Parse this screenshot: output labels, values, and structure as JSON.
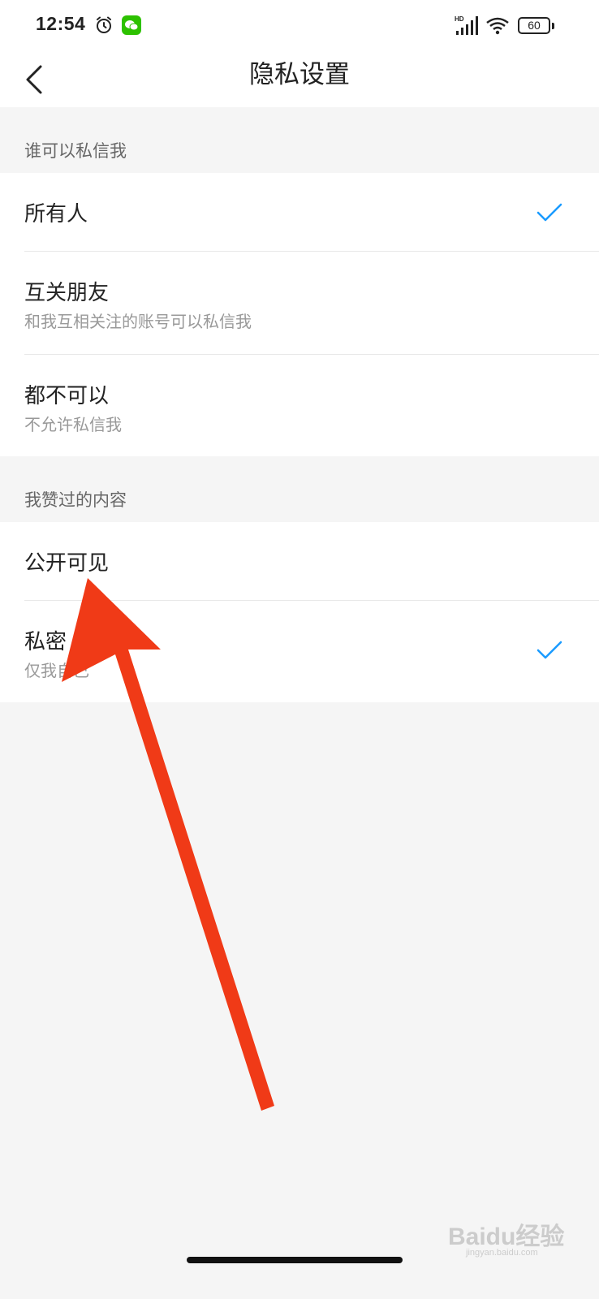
{
  "status_bar": {
    "time": "12:54",
    "network": "HD",
    "battery": "60",
    "icons": [
      "alarm-icon",
      "wechat-icon",
      "signal-icon",
      "wifi-icon",
      "battery-icon"
    ]
  },
  "nav": {
    "title": "隐私设置",
    "back_icon": "chevron-left-icon"
  },
  "sections": [
    {
      "header": "谁可以私信我",
      "items": [
        {
          "title": "所有人",
          "subtitle": "",
          "checked": true
        },
        {
          "title": "互关朋友",
          "subtitle": "和我互相关注的账号可以私信我",
          "checked": false
        },
        {
          "title": "都不可以",
          "subtitle": "不允许私信我",
          "checked": false
        }
      ]
    },
    {
      "header": "我赞过的内容",
      "items": [
        {
          "title": "公开可见",
          "subtitle": "",
          "checked": false
        },
        {
          "title": "私密",
          "subtitle": "仅我自己",
          "checked": true
        }
      ]
    }
  ],
  "colors": {
    "check": "#1a9bff",
    "arrow": "#f03a17",
    "background": "#f5f5f5"
  },
  "watermark": {
    "text": "Baidu经验",
    "sub": "jingyan.baidu.com"
  }
}
